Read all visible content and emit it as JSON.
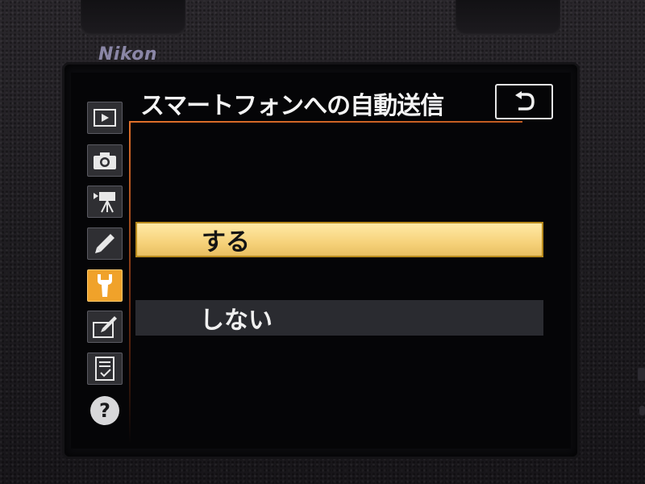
{
  "camera": {
    "brand": "Nikon"
  },
  "menu": {
    "title": "スマートフォンへの自動送信",
    "tabs": [
      {
        "name": "playback-menu",
        "icon": "playback-icon",
        "active": false
      },
      {
        "name": "shooting-menu",
        "icon": "camera-icon",
        "active": false
      },
      {
        "name": "movie-menu",
        "icon": "movie-camera-icon",
        "active": false
      },
      {
        "name": "custom-settings-menu",
        "icon": "pencil-icon",
        "active": false
      },
      {
        "name": "setup-menu",
        "icon": "wrench-icon",
        "active": true
      },
      {
        "name": "retouch-menu",
        "icon": "retouch-icon",
        "active": false
      },
      {
        "name": "my-menu",
        "icon": "my-menu-icon",
        "active": false
      }
    ],
    "help": {
      "label": "?",
      "icon": "help-icon"
    },
    "back": {
      "icon": "return-icon"
    },
    "options": [
      {
        "label": "する",
        "selected": true
      },
      {
        "label": "しない",
        "selected": false
      }
    ]
  },
  "colors": {
    "accent": "#f0a22a",
    "selected_bg": "#f6d27a",
    "selected_border": "#b88a1c",
    "divider": "#e0702a",
    "unselected_bg": "#2a2b30"
  }
}
